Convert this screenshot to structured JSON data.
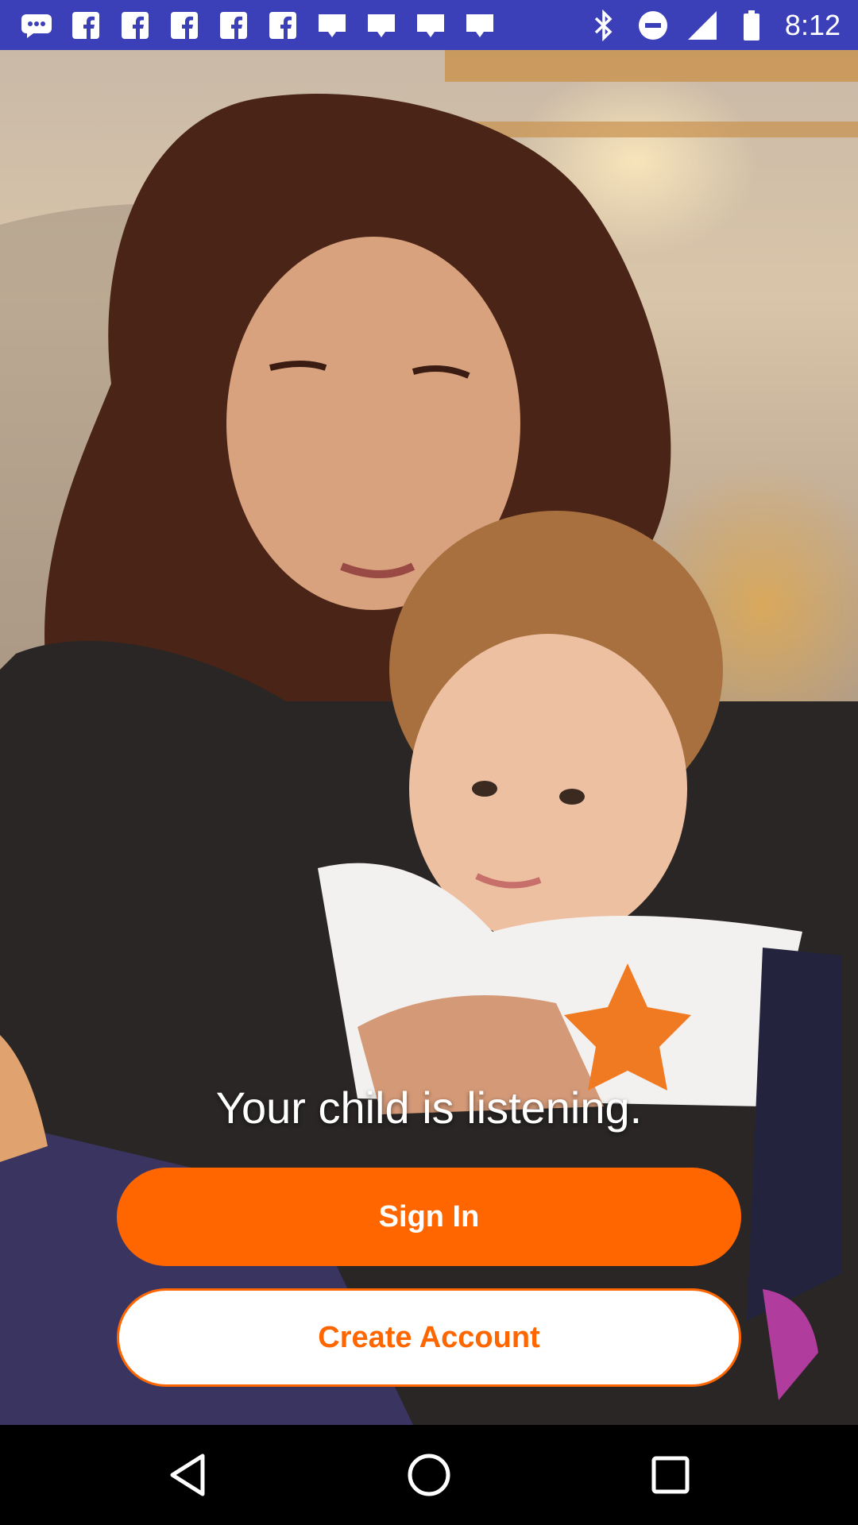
{
  "status_bar": {
    "time": "8:12",
    "left_icons": [
      "chat-bubble-icon",
      "facebook-icon",
      "facebook-icon",
      "facebook-icon",
      "facebook-icon",
      "facebook-icon",
      "tag-icon",
      "tag-icon",
      "tag-icon",
      "tag-icon"
    ],
    "right_icons": [
      "bluetooth-icon",
      "do-not-disturb-icon",
      "signal-icon",
      "battery-icon"
    ]
  },
  "hero": {
    "tagline": "Your child is listening."
  },
  "actions": {
    "sign_in_label": "Sign In",
    "create_account_label": "Create Account"
  },
  "colors": {
    "accent": "#ff6600",
    "status_bar": "#3b3fb8"
  },
  "nav_bar": {
    "buttons": [
      "back-icon",
      "home-icon",
      "recents-icon"
    ]
  }
}
